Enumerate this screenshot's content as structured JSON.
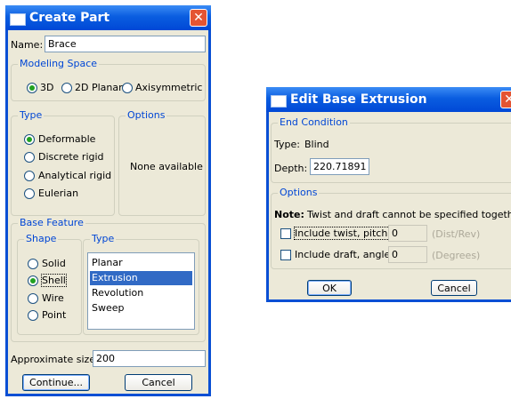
{
  "create_part": {
    "title": "Create Part",
    "name_label": "Name:",
    "name_value": "Brace",
    "modeling_space": {
      "label": "Modeling Space",
      "options": [
        "3D",
        "2D Planar",
        "Axisymmetric"
      ],
      "selected": "3D"
    },
    "type": {
      "label": "Type",
      "options": [
        "Deformable",
        "Discrete rigid",
        "Analytical rigid",
        "Eulerian"
      ],
      "selected": "Deformable"
    },
    "options": {
      "label": "Options",
      "text": "None available"
    },
    "base_feature": {
      "label": "Base Feature",
      "shape_label": "Shape",
      "shape_options": [
        "Solid",
        "Shell",
        "Wire",
        "Point"
      ],
      "shape_selected": "Shell",
      "type_label": "Type",
      "type_list": [
        "Planar",
        "Extrusion",
        "Revolution",
        "Sweep"
      ],
      "type_selected": "Extrusion"
    },
    "approx_size_label": "Approximate size:",
    "approx_size_value": "200",
    "continue_label": "Continue...",
    "cancel_label": "Cancel"
  },
  "edit_extrusion": {
    "title": "Edit Base Extrusion",
    "end_condition_label": "End Condition",
    "type_label": "Type:",
    "type_value": "Blind",
    "depth_label": "Depth:",
    "depth_value": "220.71891",
    "options_label": "Options",
    "note_bold": "Note:",
    "note_text": "Twist and draft cannot be specified together.",
    "twist_label": "Include twist, pitch:",
    "twist_value": "0",
    "twist_unit": "(Dist/Rev)",
    "draft_label": "Include draft, angle:",
    "draft_value": "0",
    "draft_unit": "(Degrees)",
    "ok_label": "OK",
    "cancel_label": "Cancel"
  }
}
